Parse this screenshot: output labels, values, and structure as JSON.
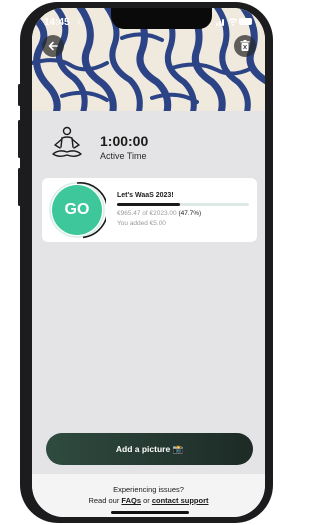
{
  "status_bar": {
    "time": "14:45",
    "moon_icon": "moon-icon"
  },
  "header": {
    "back_icon": "arrow-left-icon",
    "delete_icon": "trash-icon"
  },
  "activity": {
    "time": "1:00:00",
    "label": "Active Time",
    "icon": "meditation-icon"
  },
  "campaign": {
    "badge": "GO",
    "title": "Let's WaaS 2023!",
    "raised": "€965.47 of €2023.00",
    "percent": "(47.7%)",
    "added": "You added €5.00",
    "progress_fraction": 0.477
  },
  "actions": {
    "add_picture_label": "Add a picture 📸"
  },
  "footer": {
    "issues": "Experiencing issues?",
    "read_our": "Read our ",
    "faqs": "FAQs",
    "or": " or ",
    "contact": "contact support"
  },
  "colors": {
    "accent": "#3dc79a",
    "button": "#2f4b40",
    "hero_stripe": "#2c4486",
    "hero_bg": "#efe9de"
  }
}
